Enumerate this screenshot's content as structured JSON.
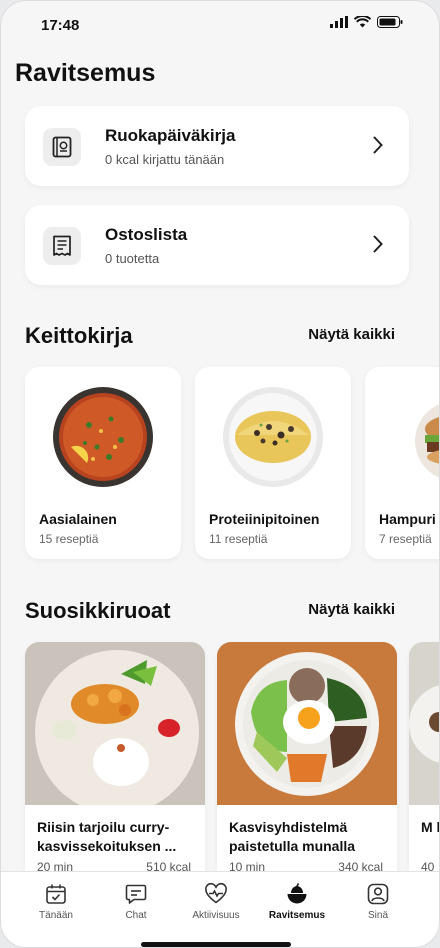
{
  "status_bar": {
    "time": "17:48"
  },
  "page": {
    "title": "Ravitsemus"
  },
  "diary_card": {
    "title": "Ruokapäiväkirja",
    "subtitle": "0 kcal kirjattu tänään"
  },
  "shopping_card": {
    "title": "Ostoslista",
    "subtitle": "0 tuotetta"
  },
  "cookbook": {
    "title": "Keittokirja",
    "see_all": "Näytä kaikki",
    "items": [
      {
        "name": "Aasialainen",
        "count": "15 reseptiä"
      },
      {
        "name": "Proteiinipitoinen",
        "count": "11 reseptiä"
      },
      {
        "name": "Hampuri",
        "count": "7 reseptiä"
      }
    ]
  },
  "favorites": {
    "title": "Suosikkiruoat",
    "see_all": "Näytä kaikki",
    "items": [
      {
        "name": "Riisin tarjoilu curry-kasvissekoituksen ...",
        "time": "20 min",
        "kcal": "510 kcal"
      },
      {
        "name": "Kasvisyhdistelmä paistetulla munalla",
        "time": "10 min",
        "kcal": "340 kcal"
      },
      {
        "name": "M ka",
        "time": "40"
      }
    ]
  },
  "tabbar": {
    "items": [
      {
        "label": "Tänään"
      },
      {
        "label": "Chat"
      },
      {
        "label": "Aktiivisuus"
      },
      {
        "label": "Ravitsemus"
      },
      {
        "label": "Sinä"
      }
    ],
    "active": "Ravitsemus"
  }
}
